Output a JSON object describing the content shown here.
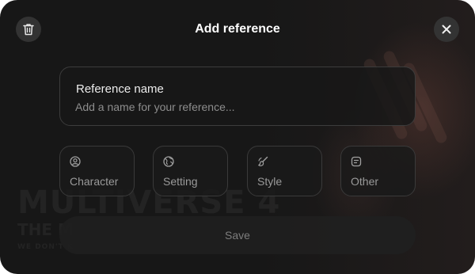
{
  "dialog": {
    "title": "Add reference"
  },
  "reference_name": {
    "label": "Reference name",
    "placeholder": "Add a name for your reference..."
  },
  "reference_types": [
    {
      "label": "Character",
      "icon": "user-circle-icon"
    },
    {
      "label": "Setting",
      "icon": "globe-icon"
    },
    {
      "label": "Style",
      "icon": "brush-icon"
    },
    {
      "label": "Other",
      "icon": "note-icon"
    }
  ],
  "save": {
    "label": "Save"
  },
  "background": {
    "headline": "MULTIVERSE 4",
    "subline": "THE M",
    "tagline": "WE DON'T K"
  },
  "colors": {
    "dialog_bg": "#171717",
    "border": "#3c3c3c",
    "muted_text": "#9a9a9a"
  }
}
